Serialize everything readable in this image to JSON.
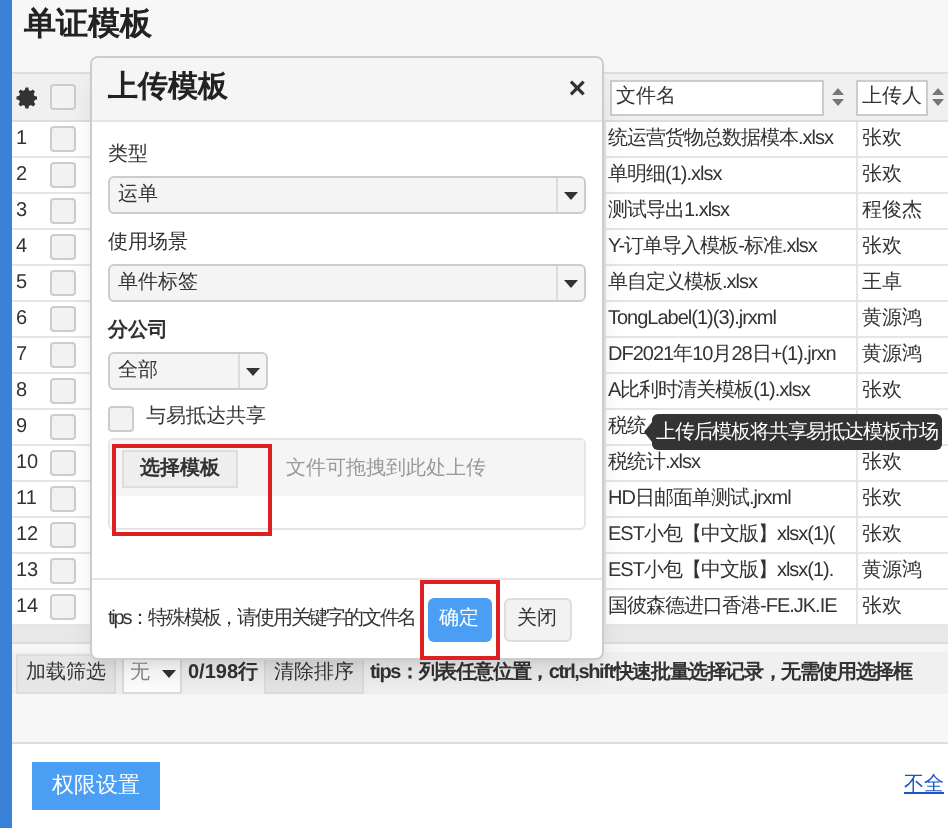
{
  "page_title": "单证模板",
  "table": {
    "select_all_checked": false,
    "columns": [
      {
        "label": "文件名"
      },
      {
        "label": "上传人"
      }
    ],
    "rows": [
      {
        "number": "1",
        "checked": false,
        "file_name": "统运营货物总数据模本.xlsx",
        "uploader": "张欢"
      },
      {
        "number": "2",
        "checked": false,
        "file_name": "单明细(1).xlsx",
        "uploader": "张欢"
      },
      {
        "number": "3",
        "checked": false,
        "file_name": "测试导出1.xlsx",
        "uploader": "程俊杰"
      },
      {
        "number": "4",
        "checked": false,
        "file_name": "Y-订单导入模板-标准.xlsx",
        "uploader": "张欢"
      },
      {
        "number": "5",
        "checked": false,
        "file_name": "单自定义模板.xlsx",
        "uploader": "王卓"
      },
      {
        "number": "6",
        "checked": false,
        "file_name": "TongLabel(1)(3).jrxml",
        "uploader": "黄源鸿"
      },
      {
        "number": "7",
        "checked": false,
        "file_name": "DF2021年10月28日+(1).jrxn",
        "uploader": "黄源鸿"
      },
      {
        "number": "8",
        "checked": false,
        "file_name": "A比利时清关模板(1).xlsx",
        "uploader": "张欢"
      },
      {
        "number": "9",
        "checked": false,
        "file_name": "税统"
      },
      {
        "number": "10",
        "checked": false,
        "file_name": "税统计.xlsx",
        "uploader": "张欢"
      },
      {
        "number": "11",
        "checked": false,
        "file_name": "HD日邮面单测试.jrxml",
        "uploader": "张欢"
      },
      {
        "number": "12",
        "checked": false,
        "file_name": "EST小包【中文版】xlsx(1)(",
        "uploader": "张欢"
      },
      {
        "number": "13",
        "checked": false,
        "file_name": "EST小包【中文版】xlsx(1).",
        "uploader": "黄源鸿"
      },
      {
        "number": "14",
        "checked": false,
        "file_name": "国彼森德进口香港-FE.JK.IE",
        "uploader": "张欢"
      }
    ]
  },
  "toolbar": {
    "load_filter": "加载筛选",
    "filter_select": "无",
    "row_count": "0/198行",
    "clear_sort": "清除排序",
    "tips": "tips：列表任意位置，ctrl,shift快速批量选择记录，无需使用选择框"
  },
  "footer": {
    "button": "权限设置",
    "link": "不全"
  },
  "tooltip": "上传后模板将共享易抵达模板市场",
  "modal": {
    "title": "上传模板",
    "close": "×",
    "fields": [
      {
        "label": "类型",
        "value": "运单",
        "wide": true
      },
      {
        "label": "使用场景",
        "value": "单件标签",
        "wide": true
      },
      {
        "label": "分公司",
        "value": "全部",
        "wide": false
      }
    ],
    "share": {
      "label": "与易抵达共享",
      "checked": false
    },
    "choose_button": "选择模板",
    "drop_hint": "文件可拖拽到此处上传",
    "tips": "tips：特殊模板，请使用关键字的文件名",
    "ok": "确定",
    "cancel": "关闭"
  }
}
